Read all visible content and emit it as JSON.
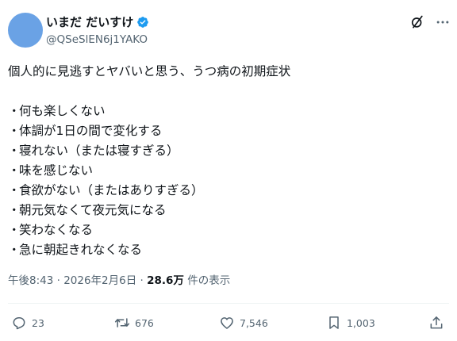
{
  "post": {
    "author": {
      "name": "いまだ だいすけ",
      "handle": "@QSeSlEN6j1YAKO",
      "verified": true,
      "avatar_color": "#6aa2e5",
      "verified_color": "#1d9bf0"
    },
    "top_icons": [
      "grok-icon",
      "more-icon"
    ],
    "intro": "個人的に見逃すとヤバいと思う、うつ病の初期症状",
    "bullet": "・",
    "items": [
      "何も楽しくない",
      "体調が1日の間で変化する",
      "寝れない（または寝すぎる）",
      "味を感じない",
      "食欲がない（またはありすぎる）",
      "朝元気なくて夜元気になる",
      "笑わなくなる",
      "急に朝起きれなくなる"
    ],
    "meta": {
      "time": "午後8:43",
      "separator": " · ",
      "date": "2026年2月6日",
      "views_count": "28.6万",
      "views_label": " 件の表示"
    },
    "actions": {
      "replies": "23",
      "reposts": "676",
      "likes": "7,546",
      "bookmarks": "1,003"
    }
  }
}
